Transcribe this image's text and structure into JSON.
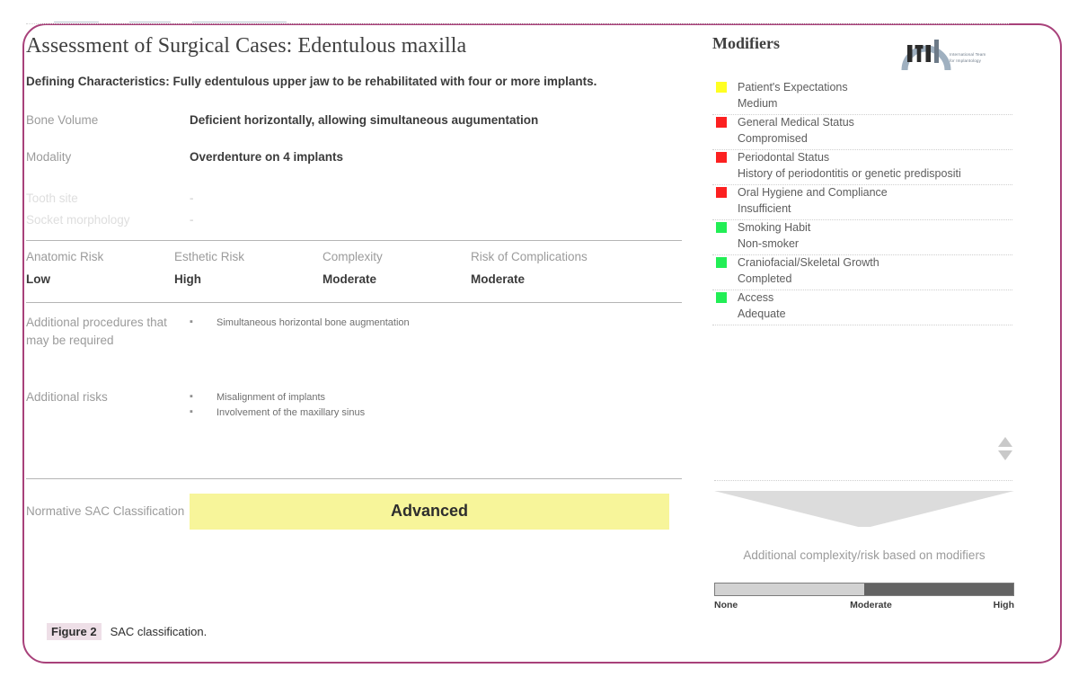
{
  "figure": {
    "number_label": "Figure 2",
    "caption": "SAC classification."
  },
  "sheet": {
    "title": "Assessment of Surgical Cases: Edentulous maxilla",
    "defining_characteristics": "Defining Characteristics: Fully edentulous upper jaw to be rehabilitated with four or more implants.",
    "fields": [
      {
        "label": "Bone Volume",
        "value": "Deficient horizontally, allowing simultaneous augumentation",
        "muted": false
      },
      {
        "label": "Modality",
        "value": "Overdenture on 4 implants",
        "muted": false
      },
      {
        "label": "Tooth site",
        "value": "-",
        "muted": true
      },
      {
        "label": "Socket morphology",
        "value": "-",
        "muted": true
      }
    ],
    "risk_table": {
      "headers": [
        "Anatomic Risk",
        "Esthetic Risk",
        "Complexity",
        "Risk of Complications"
      ],
      "values": [
        "Low",
        "High",
        "Moderate",
        "Moderate"
      ]
    },
    "additional_procedures": {
      "label": "Additional procedures that may be required",
      "items": [
        "Simultaneous horizontal bone augmentation"
      ]
    },
    "additional_risks": {
      "label": "Additional risks",
      "items": [
        "Misalignment of implants",
        "Involvement of the maxillary sinus"
      ]
    },
    "sac": {
      "label": "Normative SAC Classification",
      "value": "Advanced",
      "banner_color": "#f7f59a"
    }
  },
  "modifiers": {
    "title": "Modifiers",
    "items": [
      {
        "name": "Patient's Expectations",
        "value": "Medium",
        "color": "#ffff22"
      },
      {
        "name": "General Medical Status",
        "value": "Compromised",
        "color": "#fc2020"
      },
      {
        "name": "Periodontal Status",
        "value": "History of periodontitis or genetic predispositi",
        "color": "#fc2020"
      },
      {
        "name": "Oral Hygiene and Compliance",
        "value": "Insufficient",
        "color": "#fc2020"
      },
      {
        "name": "Smoking Habit",
        "value": "Non-smoker",
        "color": "#22ee55"
      },
      {
        "name": "Craniofacial/Skeletal Growth",
        "value": "Completed",
        "color": "#22ee55"
      },
      {
        "name": "Access",
        "value": "Adequate",
        "color": "#22ee55"
      }
    ],
    "funnel_caption": "Additional complexity/risk based on modifiers",
    "meter": {
      "labels": [
        "None",
        "Moderate",
        "High"
      ],
      "fill_percent": 50,
      "fill_color": "#d2d2d2",
      "rest_color": "#636363"
    }
  },
  "logo": {
    "wordmark": "ITI",
    "line1": "International Team",
    "line2": "for Implantology"
  }
}
